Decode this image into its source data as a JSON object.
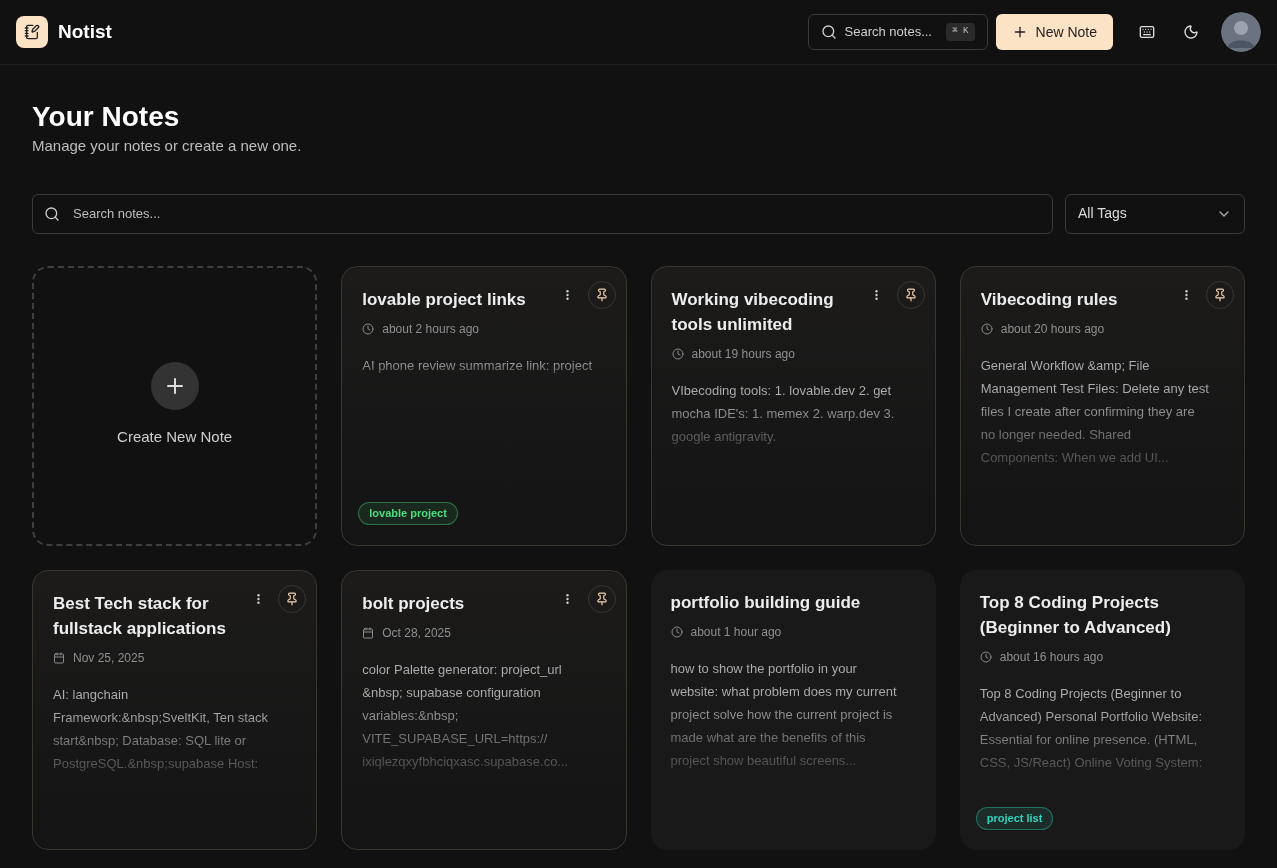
{
  "app": {
    "name": "Notist"
  },
  "header": {
    "search_placeholder": "Search notes...",
    "shortcut": "⌘ K",
    "new_note": "New Note"
  },
  "page": {
    "title": "Your Notes",
    "subtitle": "Manage your notes or create a new one."
  },
  "filters": {
    "search_placeholder": "Search notes...",
    "tag_select": "All Tags"
  },
  "create_card": {
    "label": "Create New Note"
  },
  "notes": [
    {
      "kind": "relative",
      "title": "lovable project links",
      "date": "about 2 hours ago",
      "preview": "AI phone review summarize link: project",
      "pinned": true,
      "tags": [
        {
          "label": "lovable project",
          "color": "#4ade80"
        }
      ]
    },
    {
      "kind": "relative",
      "title": "Working vibecoding tools unlimited",
      "date": "about 19 hours ago",
      "preview": "VIbecoding tools: 1. lovable.dev 2. get mocha IDE's: 1. memex 2. warp.dev 3. google antigravity.",
      "pinned": true
    },
    {
      "kind": "relative",
      "title": "Vibecoding rules",
      "date": "about 20 hours ago",
      "preview": "General Workflow &amp; File Management Test Files: Delete any test files I create after confirming they are no longer needed. Shared Components: When we add UI...",
      "pinned": true
    },
    {
      "kind": "calendar",
      "title": "Best Tech stack for fullstack applications",
      "date": "Nov 25, 2025",
      "preview": "AI: langchain Framework:&nbsp;SveltKit, Ten stack start&nbsp; Database: SQL lite or PostgreSQL.&nbsp;supabase Host:",
      "pinned": true
    },
    {
      "kind": "calendar",
      "title": "bolt projects",
      "date": "Oct 28, 2025",
      "preview": "color Palette generator: project_url &nbsp; supabase configuration variables:&nbsp; VITE_SUPABASE_URL=https:// ixiqlezqxyfbhciqxasc.supabase.co...",
      "pinned": true
    },
    {
      "kind": "relative",
      "title": "portfolio building guide",
      "date": "about 1 hour ago",
      "preview": "how to show the portfolio in your website: what problem does my current project solve how the current project is made what are the benefits of this project show beautiful screens...",
      "pinned": false
    },
    {
      "kind": "relative",
      "title": "Top 8 Coding Projects (Beginner to Advanced)",
      "date": "about 16 hours ago",
      "preview": "Top 8 Coding Projects (Beginner to Advanced) Personal Portfolio Website: Essential for online presence. (HTML, CSS, JS/React) Online Voting System:",
      "pinned": false,
      "tags": [
        {
          "label": "project list",
          "color": "#2dd4bf"
        }
      ]
    }
  ]
}
